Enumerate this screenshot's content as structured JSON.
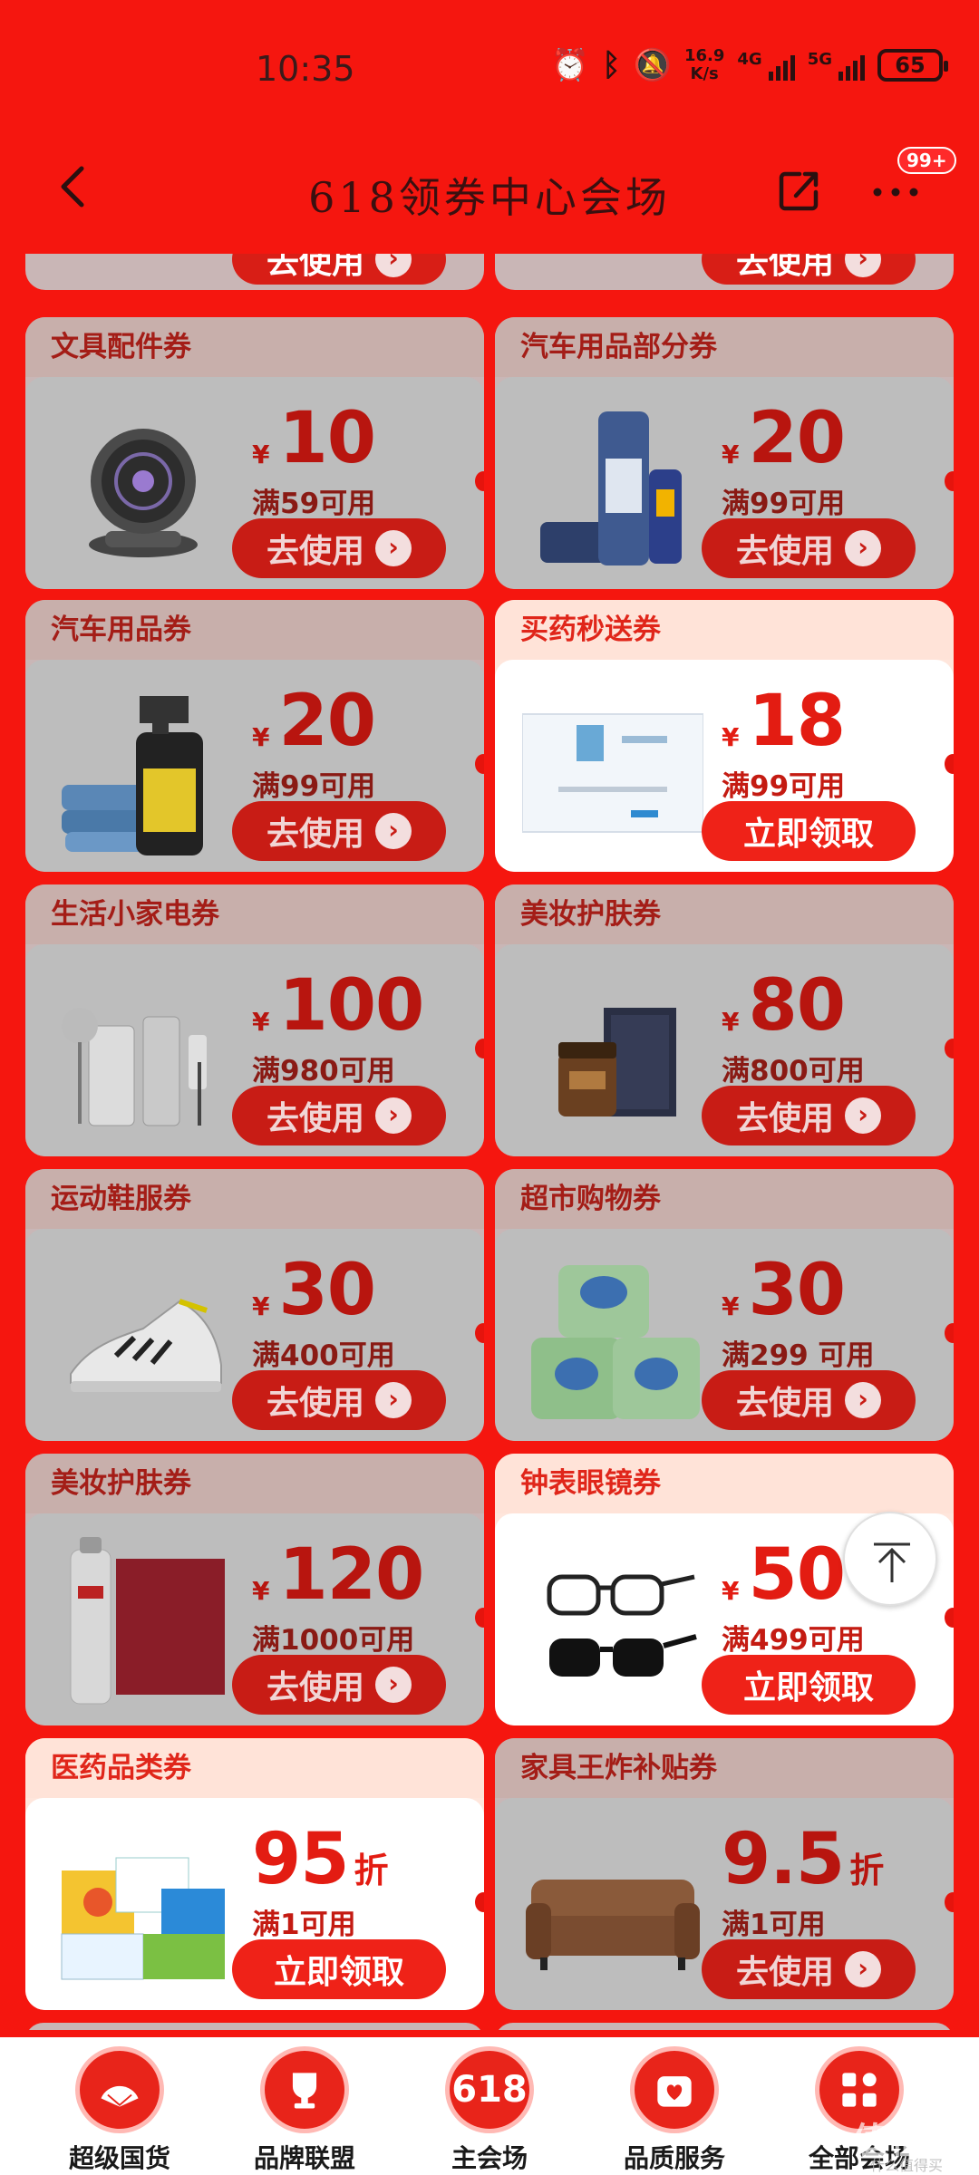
{
  "status": {
    "time": "10:35",
    "net_speed_top": "16.9",
    "net_speed_bottom": "K/s",
    "sig1": "4G",
    "sig2": "5G",
    "battery": "65"
  },
  "nav": {
    "title": "618领券中心会场",
    "badge": "99+"
  },
  "top_partial": {
    "left_button": "去使用",
    "right_button": "去使用"
  },
  "coupons": [
    {
      "title": "文具配件券",
      "amount": "10",
      "unit": "",
      "condition": "满59可用",
      "button": "去使用",
      "state": "dim",
      "product": "desk-fan"
    },
    {
      "title": "汽车用品部分券",
      "amount": "20",
      "unit": "",
      "condition": "满99可用",
      "button": "去使用",
      "state": "dim",
      "product": "car-spray"
    },
    {
      "title": "汽车用品券",
      "amount": "20",
      "unit": "",
      "condition": "满99可用",
      "button": "去使用",
      "state": "dim",
      "product": "spray-bottle"
    },
    {
      "title": "买药秒送券",
      "amount": "18",
      "unit": "",
      "condition": "满99可用",
      "button": "立即领取",
      "state": "lit",
      "product": "medicine-box"
    },
    {
      "title": "生活小家电券",
      "amount": "100",
      "unit": "",
      "condition": "满980可用",
      "button": "去使用",
      "state": "dim",
      "product": "appliances"
    },
    {
      "title": "美妆护肤券",
      "amount": "80",
      "unit": "",
      "condition": "满800可用",
      "button": "去使用",
      "state": "dim",
      "product": "cosmetic-jar"
    },
    {
      "title": "运动鞋服券",
      "amount": "30",
      "unit": "",
      "condition": "满400可用",
      "button": "去使用",
      "state": "dim",
      "product": "sneaker"
    },
    {
      "title": "超市购物券",
      "amount": "30",
      "unit": "",
      "condition": "满299 可用",
      "button": "去使用",
      "state": "dim",
      "product": "detergent-pods"
    },
    {
      "title": "美妆护肤券",
      "amount": "120",
      "unit": "",
      "condition": "满1000可用",
      "button": "去使用",
      "state": "dim",
      "product": "skii-set"
    },
    {
      "title": "钟表眼镜券",
      "amount": "50",
      "unit": "",
      "condition": "满499可用",
      "button": "立即领取",
      "state": "lit",
      "product": "glasses"
    },
    {
      "title": "医药品类券",
      "amount": "95",
      "unit": "折",
      "condition": "满1可用",
      "button": "立即领取",
      "state": "lit",
      "product": "vitamin-boxes"
    },
    {
      "title": "家具王炸补贴券",
      "amount": "9.5",
      "unit": "折",
      "condition": "满1可用",
      "button": "去使用",
      "state": "dim",
      "product": "sofa"
    }
  ],
  "tabs": [
    {
      "label": "超级国货",
      "icon": "fan-icon"
    },
    {
      "label": "品牌联盟",
      "icon": "trophy-icon"
    },
    {
      "label": "主会场",
      "icon": "618-icon",
      "icon_text": "618"
    },
    {
      "label": "品质服务",
      "icon": "heart-bag-icon"
    },
    {
      "label": "全部会场",
      "icon": "grid-icon"
    }
  ],
  "watermark": "值值值",
  "watermark_sub": "什么值得买"
}
